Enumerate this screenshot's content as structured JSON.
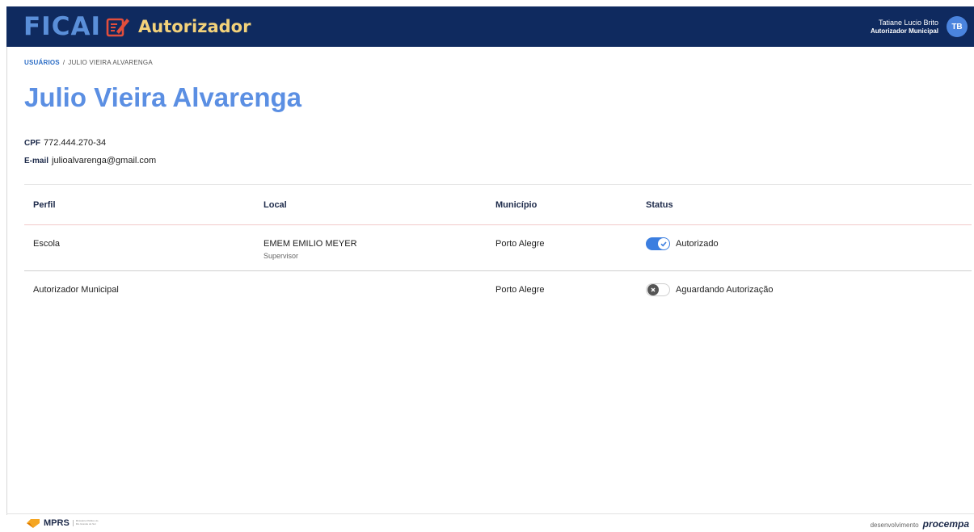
{
  "header": {
    "logo_text": "FICAI",
    "app_name": "Autorizador",
    "user_name": "Tatiane Lucio Brito",
    "user_role": "Autorizador Municipal",
    "avatar_initials": "TB",
    "colors": {
      "bar": "#0f2a5f",
      "logo": "#5a8fd9",
      "app_name": "#f3d27a",
      "avatar": "#4a84de"
    }
  },
  "breadcrumb": {
    "root": "USUÁRIOS",
    "separator": "/",
    "current": "JULIO VIEIRA ALVARENGA"
  },
  "page_title": "Julio Vieira Alvarenga",
  "info": {
    "cpf_label": "CPF",
    "cpf_value": "772.444.270-34",
    "email_label": "E-mail",
    "email_value": "julioalvarenga@gmail.com"
  },
  "table": {
    "headers": [
      "Perfil",
      "Local",
      "Município",
      "Status"
    ],
    "rows": [
      {
        "perfil": "Escola",
        "local": "EMEM EMILIO MEYER",
        "local_sub": "Supervisor",
        "municipio": "Porto Alegre",
        "status": "Autorizado",
        "toggle_on": true
      },
      {
        "perfil": "Autorizador Municipal",
        "local": "",
        "local_sub": "",
        "municipio": "Porto Alegre",
        "status": "Aguardando Autorização",
        "toggle_on": false
      }
    ]
  },
  "footer": {
    "left_logo": "MPRS",
    "left_sub": "Ministério Público do Rio Grande do Sul",
    "right_prefix": "desenvolvimento",
    "right_brand": "procempa"
  },
  "accent_color": "#3b7ee0"
}
